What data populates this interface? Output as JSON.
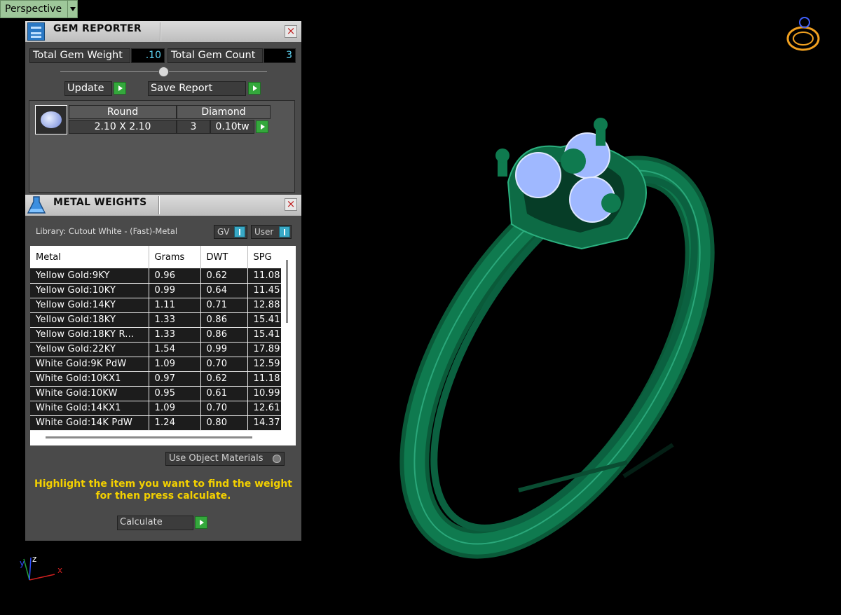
{
  "viewport": {
    "label": "Perspective"
  },
  "gem_reporter": {
    "title": "GEM REPORTER",
    "total_weight_label": "Total Gem Weight",
    "total_weight_value": ".10",
    "total_count_label": "Total Gem Count",
    "total_count_value": "3",
    "update_label": "Update",
    "save_report_label": "Save Report",
    "gem": {
      "shape": "Round",
      "material": "Diamond",
      "size": "2.10 X 2.10",
      "count": "3",
      "weight": "0.10tw"
    }
  },
  "metal_weights": {
    "title": "METAL WEIGHTS",
    "library_text": "Library: Cutout White - (Fast)-Metal",
    "gv_label": "GV",
    "user_label": "User",
    "columns": [
      "Metal",
      "Grams",
      "DWT",
      "SPG"
    ],
    "rows": [
      [
        "Yellow Gold:9KY",
        "0.96",
        "0.62",
        "11.08"
      ],
      [
        "Yellow Gold:10KY",
        "0.99",
        "0.64",
        "11.45"
      ],
      [
        "Yellow Gold:14KY",
        "1.11",
        "0.71",
        "12.88"
      ],
      [
        "Yellow Gold:18KY",
        "1.33",
        "0.86",
        "15.41"
      ],
      [
        "Yellow Gold:18KY R...",
        "1.33",
        "0.86",
        "15.41"
      ],
      [
        "Yellow Gold:22KY",
        "1.54",
        "0.99",
        "17.89"
      ],
      [
        "White Gold:9K PdW",
        "1.09",
        "0.70",
        "12.59"
      ],
      [
        "White Gold:10KX1",
        "0.97",
        "0.62",
        "11.18"
      ],
      [
        "White Gold:10KW",
        "0.95",
        "0.61",
        "10.99"
      ],
      [
        "White Gold:14KX1",
        "1.09",
        "0.70",
        "12.61"
      ],
      [
        "White Gold:14K PdW",
        "1.24",
        "0.80",
        "14.37"
      ]
    ],
    "use_object_materials_label": "Use Object Materials",
    "hint_line1": "Highlight the item you want to find the weight",
    "hint_line2": "for then press calculate.",
    "calculate_label": "Calculate"
  },
  "axis": {
    "x": "x",
    "y": "y",
    "z": "z"
  },
  "colors": {
    "model": "#0d6b45",
    "gem": "#9fb8ff",
    "hint": "#f3d000",
    "value": "#5ed3f3"
  }
}
